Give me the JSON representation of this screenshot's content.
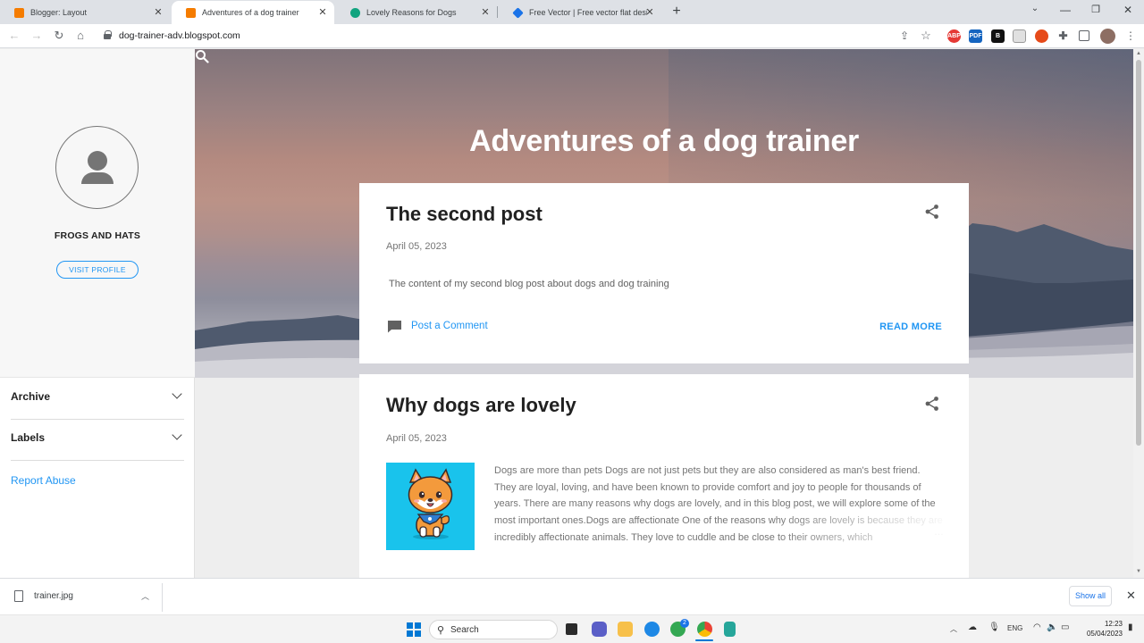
{
  "browser": {
    "tabs": [
      {
        "title": "Blogger: Layout",
        "active": false,
        "favicon_color": "#f57c00"
      },
      {
        "title": "Adventures of a dog trainer",
        "active": true,
        "favicon_color": "#f57c00"
      },
      {
        "title": "Lovely Reasons for Dogs",
        "active": false,
        "favicon_color": "#10a37f"
      },
      {
        "title": "Free Vector | Free vector flat design",
        "active": false,
        "favicon_color": "#1a73e8"
      }
    ],
    "url": "dog-trainer-adv.blogspot.com"
  },
  "sidebar": {
    "profile_name": "FROGS AND HATS",
    "visit_profile": "VISIT PROFILE",
    "widgets": [
      {
        "label": "Archive"
      },
      {
        "label": "Labels"
      }
    ],
    "report_abuse": "Report Abuse"
  },
  "blog": {
    "title": "Adventures of a dog trainer",
    "posts": [
      {
        "title": "The second post",
        "date": "April 05, 2023",
        "snippet": "The content of my second blog post about dogs and dog training",
        "comment_link": "Post a Comment",
        "read_more": "READ MORE"
      },
      {
        "title": "Why dogs are lovely",
        "date": "April 05, 2023",
        "snippet": "Dogs are more than pets Dogs are not just pets but they are also considered as man's best friend. They are loyal, loving, and have been known to provide comfort and joy to people for thousands of years. There are many reasons why dogs are lovely, and in this blog post, we will explore some of the most important ones.Dogs are affectionate One of the reasons why dogs are lovely is because they are incredibly affectionate animals. They love to cuddle and be close to their owners, which",
        "ellipsis": "…"
      }
    ]
  },
  "downloads": {
    "file_name": "trainer.jpg",
    "show_all": "Show all"
  },
  "taskbar": {
    "search_label": "Search",
    "language": "ENG",
    "time": "12:23",
    "date": "05/04/2023",
    "chat_badge": "2"
  },
  "colors": {
    "accent": "#2196f3",
    "card_bg": "#ffffff",
    "page_bg": "#eeeeee"
  }
}
